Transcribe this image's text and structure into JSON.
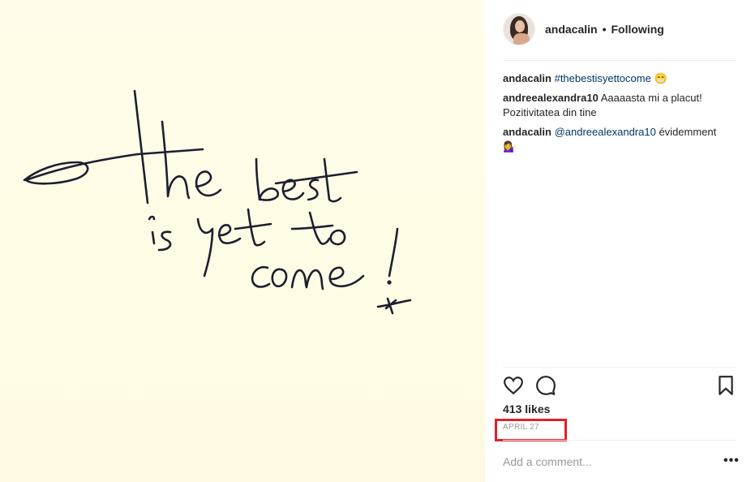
{
  "post": {
    "username": "andacalin",
    "follow_status": "Following",
    "separator": "•"
  },
  "image": {
    "handwriting_text": "The best is yet to come!"
  },
  "comments": [
    {
      "user": "andacalin",
      "tag": "#thebestisyettocome",
      "text": "",
      "emoji": "😁"
    },
    {
      "user": "andreealexandra10",
      "tag": "",
      "text": "Aaaaasta mi a placut! Pozitivitatea din tine",
      "emoji": ""
    },
    {
      "user": "andacalin",
      "tag": "@andreealexandra10",
      "text": "évidemment",
      "emoji": "💁‍♀️"
    }
  ],
  "likes": "413 likes",
  "date": "APRIL 27",
  "add_comment_placeholder": "Add a comment...",
  "more_label": "•••",
  "icons": {
    "like": "heart-icon",
    "comment": "comment-bubble-icon",
    "save": "bookmark-icon"
  },
  "colors": {
    "highlight": "#e0202a",
    "link": "#003569",
    "muted": "#999999"
  }
}
